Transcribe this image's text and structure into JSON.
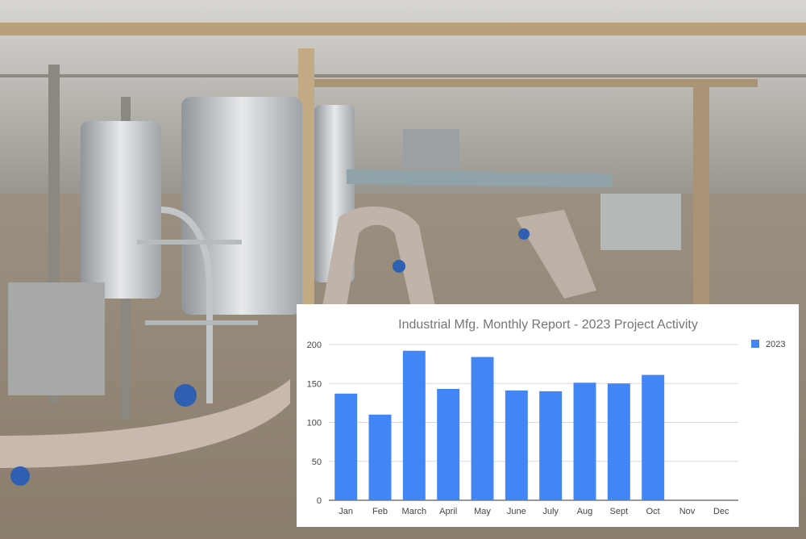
{
  "chart_data": {
    "type": "bar",
    "title": "Industrial Mfg. Monthly Report - 2023 Project Activity",
    "categories": [
      "Jan",
      "Feb",
      "March",
      "April",
      "May",
      "June",
      "July",
      "Aug",
      "Sept",
      "Oct",
      "Nov",
      "Dec"
    ],
    "series": [
      {
        "name": "2023",
        "values": [
          137,
          110,
          192,
          143,
          184,
          141,
          140,
          151,
          150,
          161,
          null,
          null
        ],
        "color": "#4285f4"
      }
    ],
    "yticks": [
      0,
      50,
      100,
      150,
      200
    ],
    "ylim": [
      0,
      200
    ],
    "grid": true,
    "legend": "right"
  }
}
